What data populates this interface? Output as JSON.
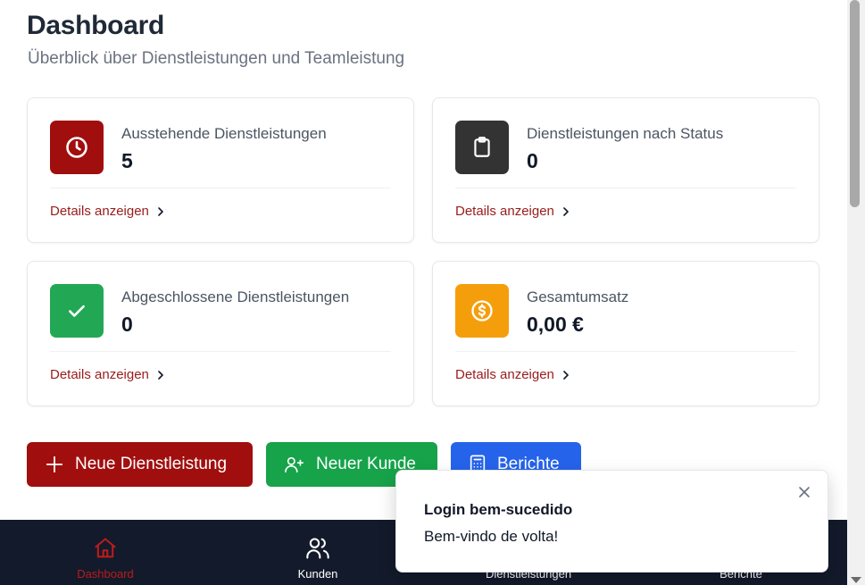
{
  "header": {
    "title": "Dashboard",
    "subtitle": "Überblick über Dienstleistungen und Teamleistung"
  },
  "cards": [
    {
      "label": "Ausstehende Dienstleistungen",
      "value": "5",
      "link": "Details anzeigen",
      "icon": "clock-icon",
      "color": "#a10e0e"
    },
    {
      "label": "Dienstleistungen nach Status",
      "value": "0",
      "link": "Details anzeigen",
      "icon": "clipboard-icon",
      "color": "#333333"
    },
    {
      "label": "Abgeschlossene Dienstleistungen",
      "value": "0",
      "link": "Details anzeigen",
      "icon": "check-icon",
      "color": "#22a855"
    },
    {
      "label": "Gesamtumsatz",
      "value": "0,00 €",
      "link": "Details anzeigen",
      "icon": "dollar-circle-icon",
      "color": "#f59e0b"
    }
  ],
  "actions": {
    "new_service": "Neue Dienstleistung",
    "new_customer": "Neuer Kunde",
    "reports": "Berichte"
  },
  "nav": {
    "items": [
      {
        "label": "Dashboard",
        "icon": "home-icon",
        "active": true
      },
      {
        "label": "Kunden",
        "icon": "users-icon",
        "active": false
      },
      {
        "label": "Dienstleistungen",
        "icon": "wrench-icon",
        "active": false
      },
      {
        "label": "Berichte",
        "icon": "chart-icon",
        "active": false
      }
    ]
  },
  "toast": {
    "title": "Login bem-sucedido",
    "message": "Bem-vindo de volta!"
  },
  "colors": {
    "accent": "#a10e0e",
    "nav_bg": "#131a2b",
    "link": "#991b1b"
  }
}
